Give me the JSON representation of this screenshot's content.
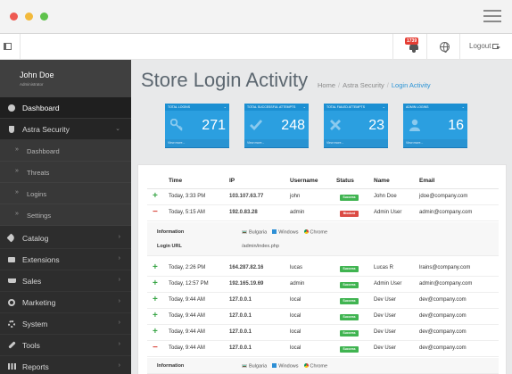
{
  "header": {
    "notification_count": "1739",
    "logout_label": "Logout"
  },
  "sidebar": {
    "user_name": "John Doe",
    "user_role": "Administrator",
    "items": [
      {
        "label": "Dashboard",
        "icon": "dashboard-icon"
      },
      {
        "label": "Astra Security",
        "icon": "shield-icon"
      },
      {
        "label": "Dashboard",
        "icon": "chevron-right-icon"
      },
      {
        "label": "Threats",
        "icon": "chevron-right-icon"
      },
      {
        "label": "Logins",
        "icon": "chevron-right-icon"
      },
      {
        "label": "Settings",
        "icon": "chevron-right-icon"
      },
      {
        "label": "Catalog",
        "icon": "tag-icon"
      },
      {
        "label": "Extensions",
        "icon": "puzzle-icon"
      },
      {
        "label": "Sales",
        "icon": "cart-icon"
      },
      {
        "label": "Marketing",
        "icon": "share-icon"
      },
      {
        "label": "System",
        "icon": "gear-icon"
      },
      {
        "label": "Tools",
        "icon": "wrench-icon"
      },
      {
        "label": "Reports",
        "icon": "bar-chart-icon"
      }
    ]
  },
  "page": {
    "title": "Store Login Activity",
    "breadcrumb": [
      "Home",
      "Astra Security",
      "Login Activity"
    ]
  },
  "tiles": [
    {
      "title": "TOTAL LOGINS",
      "value": "271",
      "footer": "View more...",
      "icon": "key-icon"
    },
    {
      "title": "TOTAL SUCCESSFUL ATTEMPTS",
      "value": "248",
      "footer": "View more...",
      "icon": "check-icon"
    },
    {
      "title": "TOTAL FAILED ATTEMPTS",
      "value": "23",
      "footer": "View more...",
      "icon": "x-icon"
    },
    {
      "title": "ADMIN LOGINS",
      "value": "16",
      "footer": "View more...",
      "icon": "user-icon"
    }
  ],
  "table": {
    "columns": [
      "Time",
      "IP",
      "Username",
      "Status",
      "Name",
      "Email"
    ],
    "rows": [
      {
        "sign": "+",
        "time": "Today, 3:33 PM",
        "ip": "103.107.63.77",
        "username": "john",
        "status": "Success",
        "name": "John Doe",
        "email": "jdoe@company.com"
      },
      {
        "sign": "−",
        "time": "Today, 5:15 AM",
        "ip": "192.0.83.28",
        "username": "admin",
        "status": "Blocked",
        "name": "Admin User",
        "email": "admin@company.com"
      },
      {
        "sign": "+",
        "time": "Today, 2:26 PM",
        "ip": "164.287.82.16",
        "username": "lucas",
        "status": "Success",
        "name": "Lucas R",
        "email": "lrains@company.com"
      },
      {
        "sign": "+",
        "time": "Today, 12:57 PM",
        "ip": "192.165.19.69",
        "username": "admin",
        "status": "Success",
        "name": "Admin User",
        "email": "admin@company.com"
      },
      {
        "sign": "+",
        "time": "Today, 9:44 AM",
        "ip": "127.0.0.1",
        "username": "local",
        "status": "Success",
        "name": "Dev User",
        "email": "dev@company.com"
      },
      {
        "sign": "+",
        "time": "Today, 9:44 AM",
        "ip": "127.0.0.1",
        "username": "local",
        "status": "Success",
        "name": "Dev User",
        "email": "dev@company.com"
      },
      {
        "sign": "+",
        "time": "Today, 9:44 AM",
        "ip": "127.0.0.1",
        "username": "local",
        "status": "Success",
        "name": "Dev User",
        "email": "dev@company.com"
      },
      {
        "sign": "−",
        "time": "Today, 9:44 AM",
        "ip": "127.0.0.1",
        "username": "local",
        "status": "Success",
        "name": "Dev User",
        "email": "dev@company.com"
      }
    ],
    "detail": {
      "info_label": "Information",
      "country": "Bulgaria",
      "os": "Windows",
      "browser": "Chrome",
      "login_url_label": "Login URL",
      "login_url": "/admin/index.php"
    }
  }
}
